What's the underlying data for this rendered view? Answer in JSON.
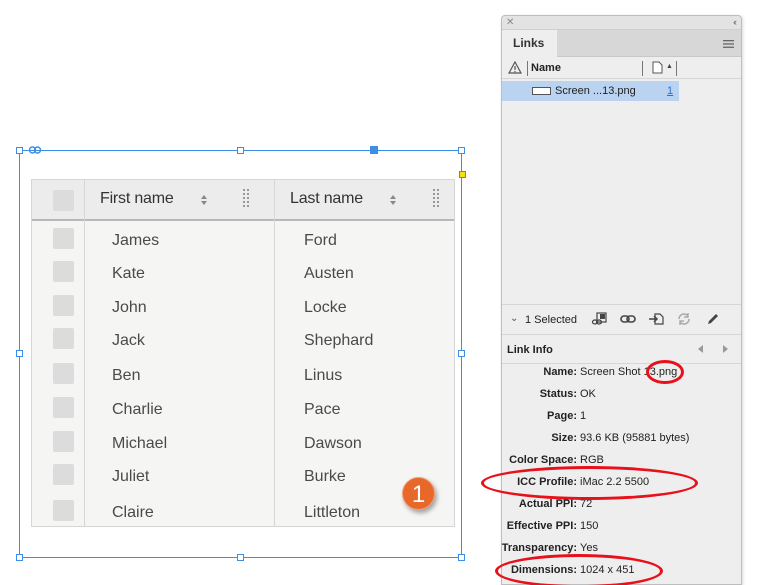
{
  "table": {
    "columns": [
      {
        "label": "First name"
      },
      {
        "label": "Last name"
      }
    ],
    "rows": [
      {
        "first": "James",
        "last": "Ford"
      },
      {
        "first": "Kate",
        "last": "Austen"
      },
      {
        "first": "John",
        "last": "Locke"
      },
      {
        "first": "Jack",
        "last": "Shephard"
      },
      {
        "first": "Ben",
        "last": "Linus"
      },
      {
        "first": "Charlie",
        "last": "Pace"
      },
      {
        "first": "Michael",
        "last": "Dawson"
      },
      {
        "first": "Juliet",
        "last": "Burke"
      },
      {
        "first": "Claire",
        "last": "Littleton"
      }
    ]
  },
  "callout": {
    "number": "1",
    "color": "#e8682a"
  },
  "panel": {
    "tab_label": "Links",
    "column_name": "Name",
    "links": [
      {
        "name": "Screen ...13.png",
        "page": "1",
        "selected": true
      }
    ],
    "selection_label": "1 Selected",
    "toolbar_icons": [
      "relink-from-cc-icon",
      "relink-icon",
      "goto-link-icon",
      "update-link-icon",
      "edit-original-icon"
    ],
    "info_title": "Link Info",
    "info": [
      {
        "key": "Name:",
        "value": "Screen Shot 13.png"
      },
      {
        "key": "Status:",
        "value": "OK"
      },
      {
        "key": "Page:",
        "value": "1"
      },
      {
        "key": "Size:",
        "value": "93.6 KB (95881 bytes)"
      },
      {
        "key": "Color Space:",
        "value": "RGB"
      },
      {
        "key": "ICC Profile:",
        "value": "iMac 2.2 5500"
      },
      {
        "key": "Actual PPI:",
        "value": "72"
      },
      {
        "key": "Effective PPI:",
        "value": "150"
      },
      {
        "key": "Transparency:",
        "value": "Yes"
      },
      {
        "key": "Dimensions:",
        "value": "1024 x 451"
      }
    ]
  },
  "annotation_color": "#e8101a",
  "selection_color": "#3d8ee6"
}
